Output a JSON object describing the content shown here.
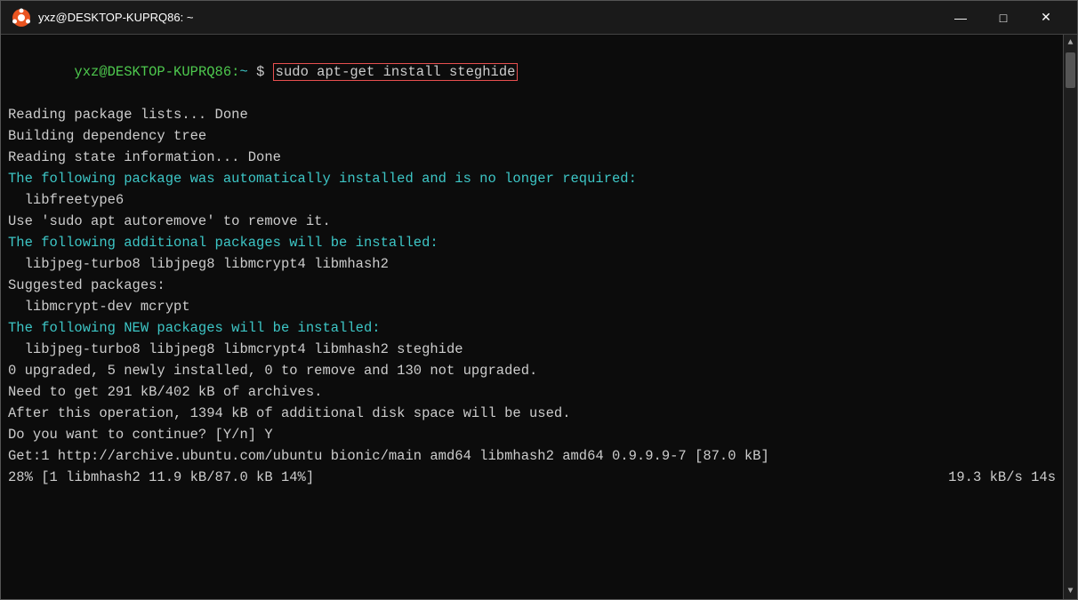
{
  "window": {
    "title": "yxz@DESKTOP-KUPRQ86: ~",
    "minimize_label": "—",
    "maximize_label": "□",
    "close_label": "✕"
  },
  "terminal": {
    "prompt_user": "yxz@DESKTOP-KUPRQ86:",
    "prompt_path": "~",
    "prompt_dollar": " $",
    "command": " sudo apt-get install steghide",
    "lines": [
      {
        "type": "info",
        "text": "Reading package lists... Done"
      },
      {
        "type": "info",
        "text": "Building dependency tree"
      },
      {
        "type": "info",
        "text": "Reading state information... Done"
      },
      {
        "type": "cyan",
        "text": "The following package was automatically installed and is no longer required:"
      },
      {
        "type": "info",
        "text": "  libfreetype6"
      },
      {
        "type": "info",
        "text": "Use 'sudo apt autoremove' to remove it."
      },
      {
        "type": "cyan",
        "text": "The following additional packages will be installed:"
      },
      {
        "type": "info",
        "text": "  libjpeg-turbo8 libjpeg8 libmcrypt4 libmhash2"
      },
      {
        "type": "info",
        "text": "Suggested packages:"
      },
      {
        "type": "info",
        "text": "  libmcrypt-dev mcrypt"
      },
      {
        "type": "cyan",
        "text": "The following NEW packages will be installed:"
      },
      {
        "type": "info",
        "text": "  libjpeg-turbo8 libjpeg8 libmcrypt4 libmhash2 steghide"
      },
      {
        "type": "info",
        "text": "0 upgraded, 5 newly installed, 0 to remove and 130 not upgraded."
      },
      {
        "type": "info",
        "text": "Need to get 291 kB/402 kB of archives."
      },
      {
        "type": "info",
        "text": "After this operation, 1394 kB of additional disk space will be used."
      },
      {
        "type": "info",
        "text": "Do you want to continue? [Y/n] Y"
      },
      {
        "type": "info",
        "text": "Get:1 http://archive.ubuntu.com/ubuntu bionic/main amd64 libmhash2 amd64 0.9.9.9-7 [87.0 kB]"
      },
      {
        "type": "progress",
        "left": "28% [1 libmhash2 11.9 kB/87.0 kB 14%]",
        "right": "19.3 kB/s 14s"
      }
    ]
  },
  "scrollbar": {
    "up_arrow": "▲",
    "down_arrow": "▼"
  }
}
